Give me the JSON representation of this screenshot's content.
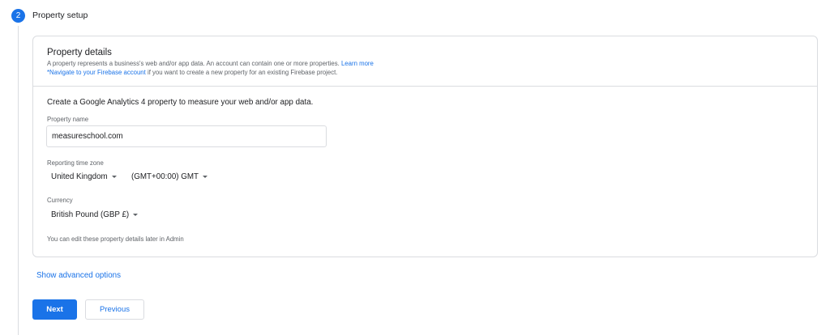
{
  "step": {
    "number": "2",
    "title": "Property setup"
  },
  "card": {
    "title": "Property details",
    "description": "A property represents a business's web and/or app data. An account can contain one or more properties.",
    "learn_more": "Learn more",
    "firebase_link": "*Navigate to your Firebase account",
    "firebase_suffix": "if you want to create a new property for an existing Firebase project.",
    "intro": "Create a Google Analytics 4 property to measure your web and/or app data.",
    "property_name_label": "Property name",
    "property_name_value": "measureschool.com",
    "timezone_label": "Reporting time zone",
    "timezone_country": "United Kingdom",
    "timezone_offset": "(GMT+00:00) GMT",
    "currency_label": "Currency",
    "currency_value": "British Pound (GBP £)",
    "footnote": "You can edit these property details later in Admin"
  },
  "advanced_options_label": "Show advanced options",
  "buttons": {
    "next": "Next",
    "previous": "Previous"
  },
  "colors": {
    "accent": "#1a73e8",
    "border": "#dadce0",
    "secondary_text": "#5f6368"
  },
  "icons": {
    "dropdown": "caret-down-icon"
  }
}
